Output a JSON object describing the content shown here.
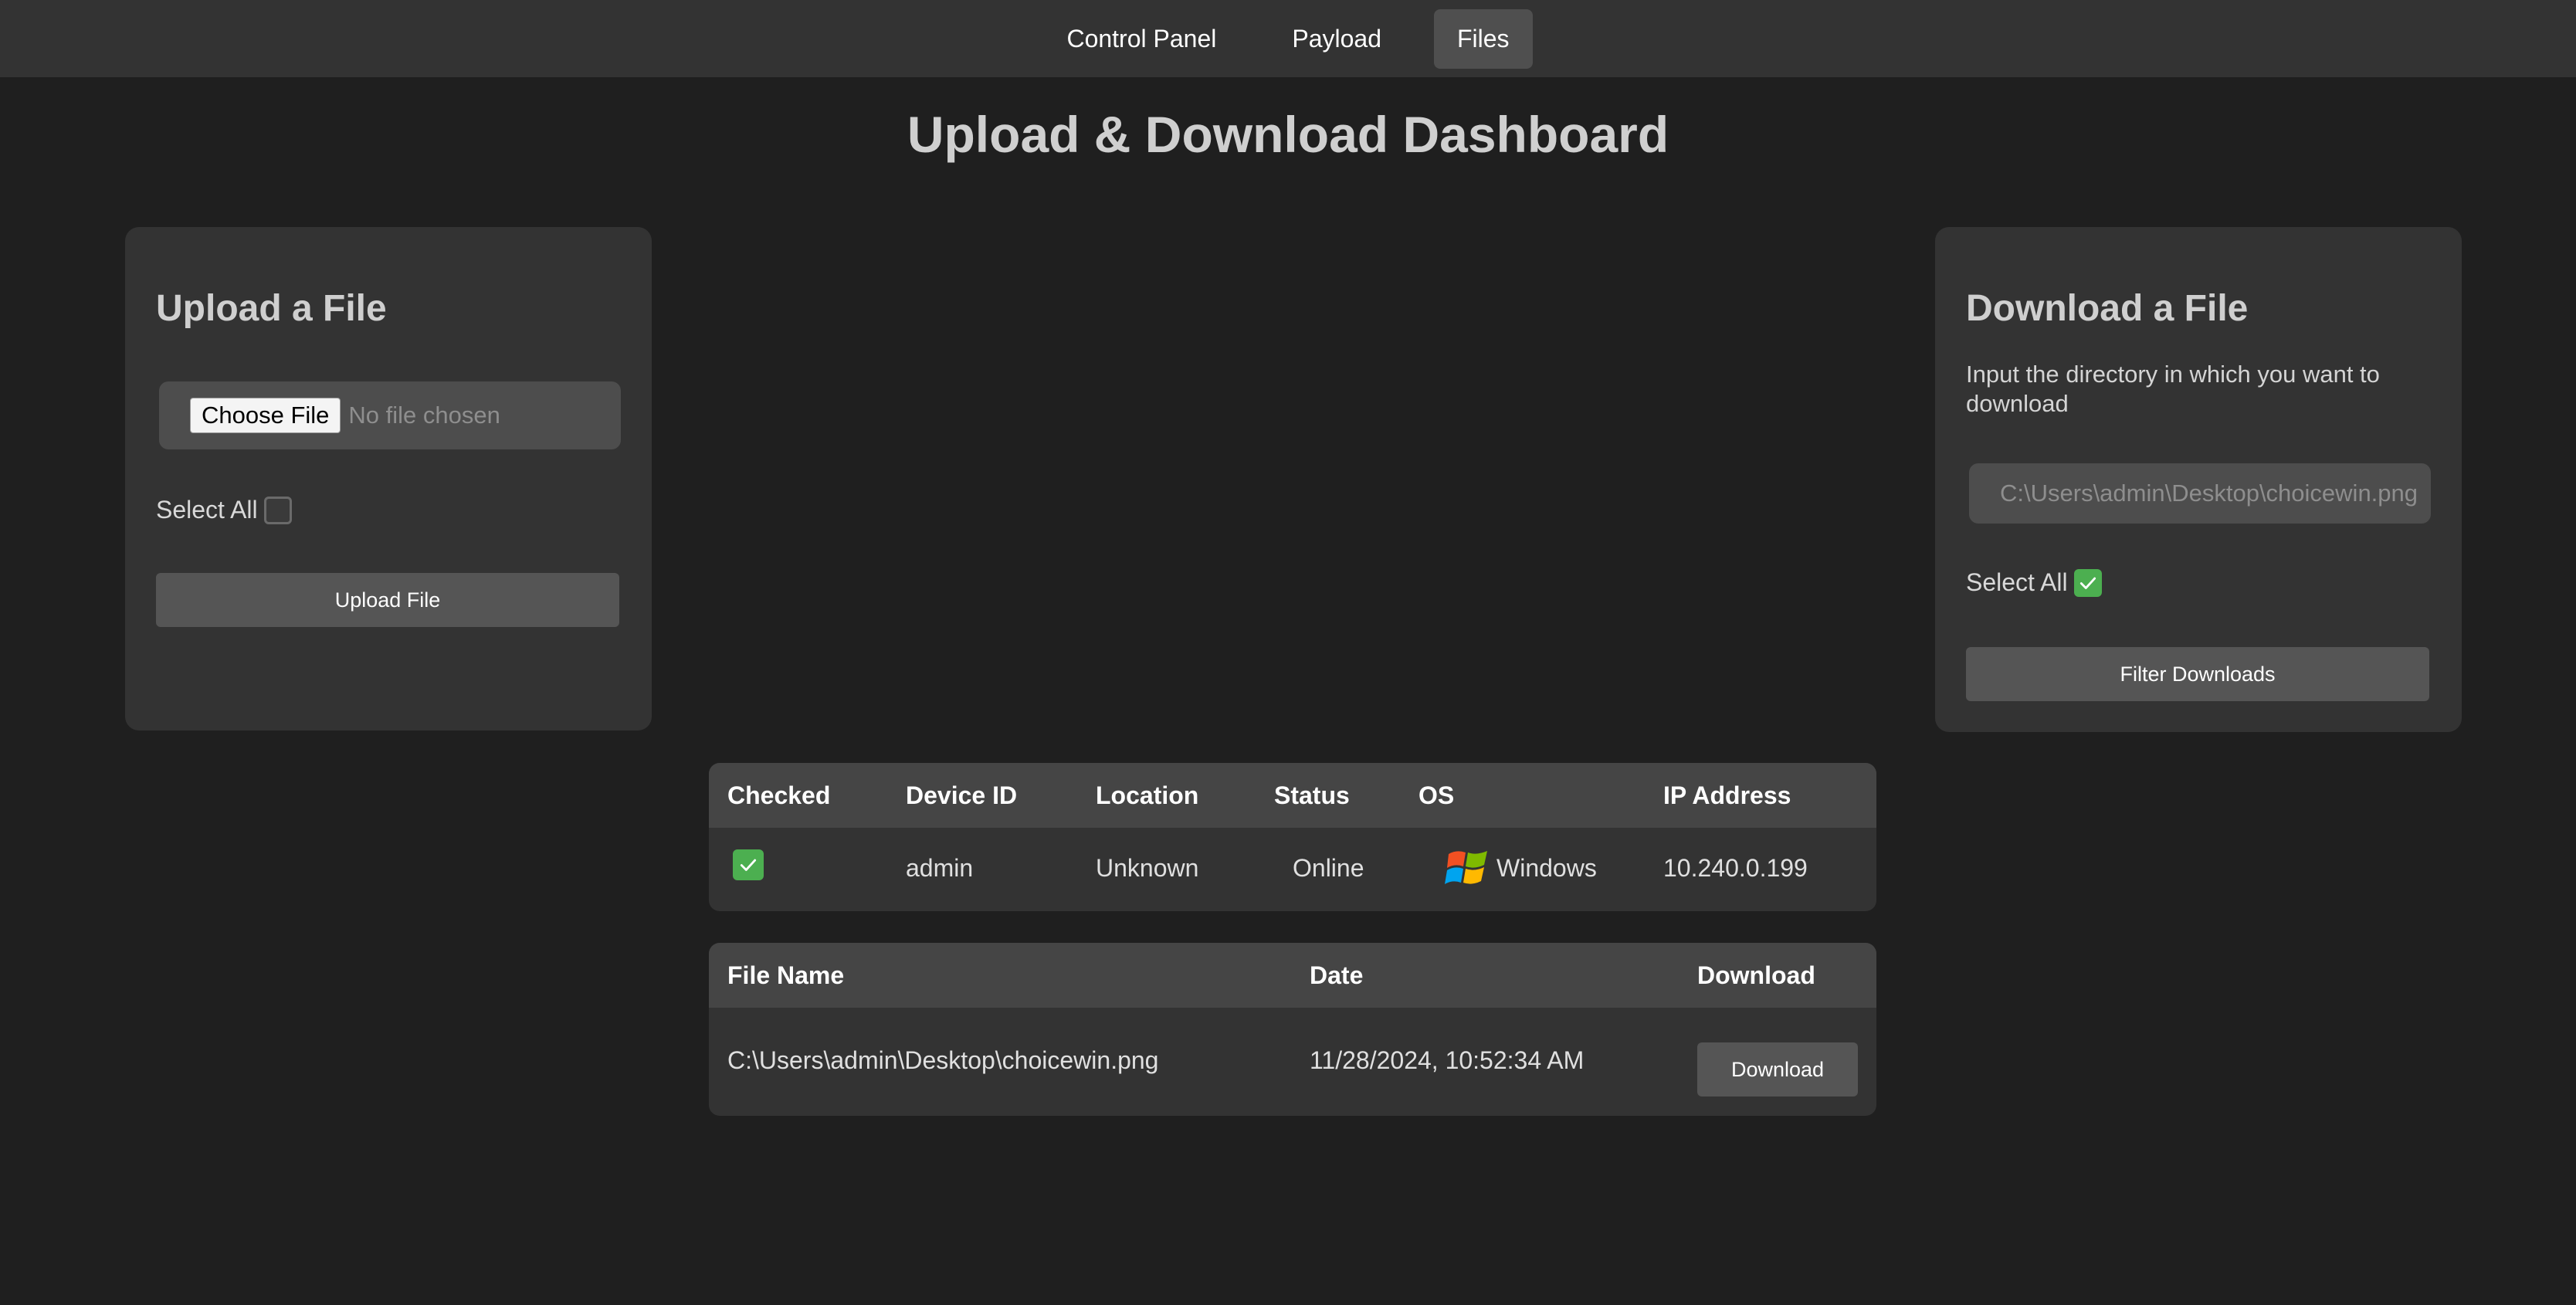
{
  "nav": {
    "items": [
      {
        "label": "Control Panel"
      },
      {
        "label": "Payload"
      },
      {
        "label": "Files"
      }
    ],
    "active": "Files"
  },
  "page": {
    "title": "Upload & Download Dashboard"
  },
  "upload": {
    "title": "Upload a File",
    "choose_label": "Choose File",
    "no_file_label": "No file chosen",
    "select_all_label": "Select All",
    "select_all_checked": false,
    "button_label": "Upload File"
  },
  "download": {
    "title": "Download a File",
    "description": "Input the directory in which you want to download",
    "directory_placeholder": "C:\\Users\\admin\\Desktop\\choicewin.png",
    "select_all_label": "Select All",
    "select_all_checked": true,
    "button_label": "Filter Downloads"
  },
  "devices": {
    "headers": {
      "checked": "Checked",
      "device_id": "Device ID",
      "location": "Location",
      "status": "Status",
      "os": "OS",
      "ip": "IP Address"
    },
    "rows": [
      {
        "checked": true,
        "device_id": "admin",
        "location": "Unknown",
        "status": "Online",
        "os": "Windows",
        "os_icon": "windows-logo-icon",
        "ip": "10.240.0.199"
      }
    ]
  },
  "files": {
    "headers": {
      "file_name": "File Name",
      "date": "Date",
      "download": "Download"
    },
    "rows": [
      {
        "file_name": "C:\\Users\\admin\\Desktop\\choicewin.png",
        "date": "11/28/2024, 10:52:34 AM",
        "download_label": "Download"
      }
    ]
  },
  "colors": {
    "background": "#1f1f1f",
    "panel": "#333333",
    "accent_check": "#4caf50"
  }
}
